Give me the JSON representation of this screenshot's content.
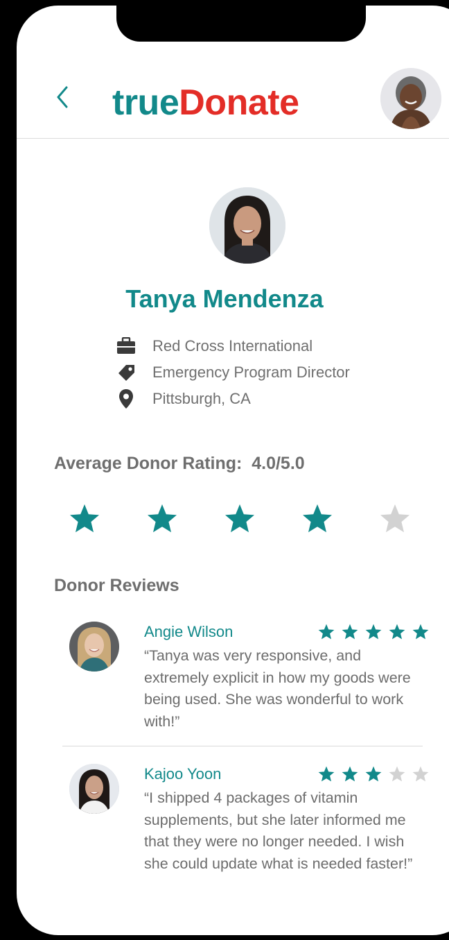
{
  "app": {
    "logo_part1": "true",
    "logo_part2": "Donate",
    "brand_teal": "#12898a",
    "brand_red": "#e32d27"
  },
  "header": {
    "back_icon": "chevron-left-icon",
    "user_avatar": "user-avatar"
  },
  "profile": {
    "name": "Tanya Mendenza",
    "organization": "Red Cross International",
    "title": "Emergency Program Director",
    "location": "Pittsburgh, CA",
    "icons": [
      "briefcase-icon",
      "tag-icon",
      "location-pin-icon"
    ]
  },
  "rating": {
    "label": "Average Donor Rating:",
    "value_text": "4.0/5.0",
    "value": 4,
    "max": 5
  },
  "reviews_section": {
    "title": "Donor Reviews",
    "reviews": [
      {
        "name": "Angie Wilson",
        "stars": 5,
        "text": "“Tanya was very responsive, and extremely explicit in how my goods were being used. She was wonderful to work with!”"
      },
      {
        "name": "Kajoo Yoon",
        "stars": 3,
        "text": "“I shipped 4 packages of vitamin supplements, but she later informed me that they were no longer needed. I wish she could update what is needed faster!”"
      }
    ]
  },
  "colors": {
    "star_filled": "#12898a",
    "star_empty": "#d2d2d2",
    "text_gray": "#6e6e6e"
  }
}
